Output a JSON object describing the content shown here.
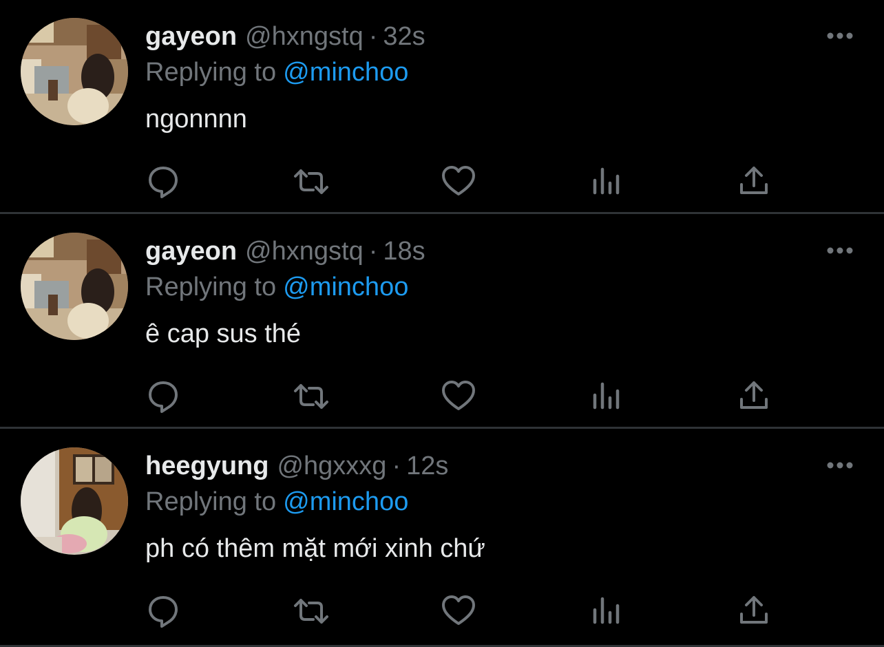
{
  "colors": {
    "background": "#000000",
    "primary_text": "#e7e9ea",
    "secondary_text": "#71767b",
    "mention": "#1d9bf0",
    "divider": "#2f3336"
  },
  "tweets": [
    {
      "display_name": "gayeon",
      "handle": "@hxngstq",
      "separator": "·",
      "time": "32s",
      "reply_prefix": "Replying to",
      "reply_to": "@minchoo",
      "text": "ngonnnn"
    },
    {
      "display_name": "gayeon",
      "handle": "@hxngstq",
      "separator": "·",
      "time": "18s",
      "reply_prefix": "Replying to",
      "reply_to": "@minchoo",
      "text": "ê cap sus thé"
    },
    {
      "display_name": "heegyung",
      "handle": "@hgxxxg",
      "separator": "·",
      "time": "12s",
      "reply_prefix": "Replying to",
      "reply_to": "@minchoo",
      "text": "ph có thêm mặt mới xinh chứ"
    }
  ],
  "icons": {
    "reply": "reply-icon",
    "retweet": "retweet-icon",
    "like": "heart-icon",
    "views": "views-icon",
    "share": "share-icon",
    "more": "more-icon"
  }
}
